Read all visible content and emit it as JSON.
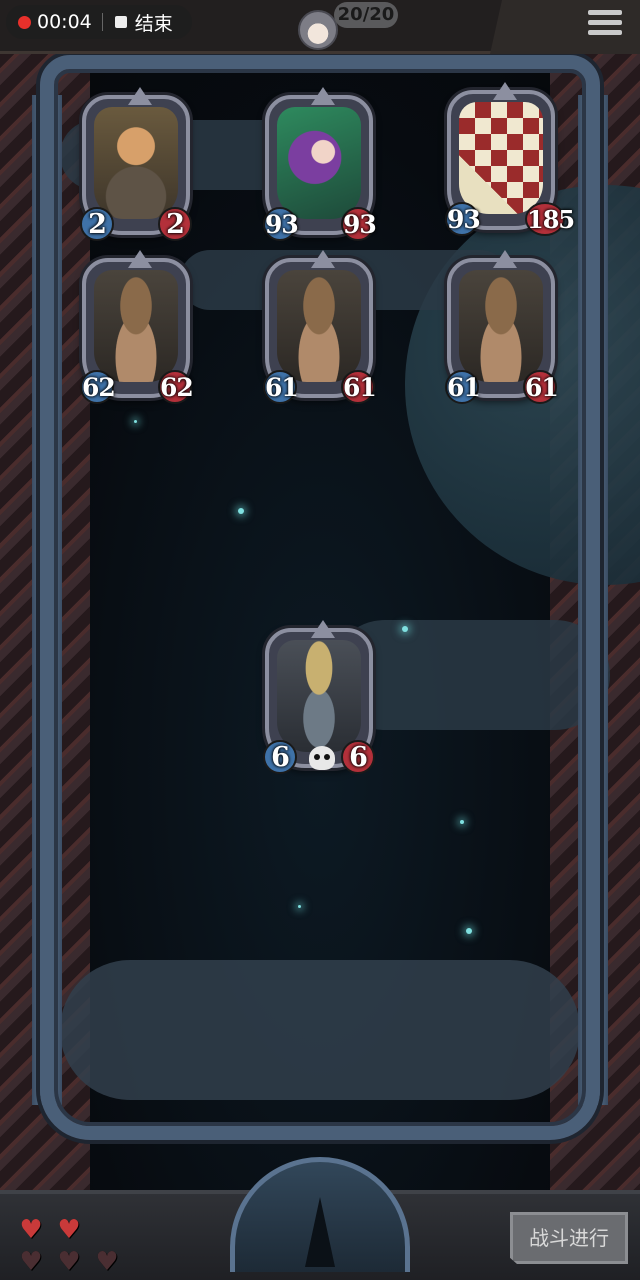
{
  "recording": {
    "time": "00:04",
    "stop_label": "结束"
  },
  "header": {
    "turn_counter": "20/20"
  },
  "enemy_cards": [
    {
      "name": "kid-card",
      "attack": "2",
      "health": "2"
    },
    {
      "name": "witch-card",
      "attack": "93",
      "health": "93"
    },
    {
      "name": "ace-card",
      "attack": "93",
      "health": "185"
    },
    {
      "name": "bucket-card-1",
      "attack": "62",
      "health": "62"
    },
    {
      "name": "bucket-card-2",
      "attack": "61",
      "health": "61"
    },
    {
      "name": "bucket-card-3",
      "attack": "61",
      "health": "61"
    }
  ],
  "player_card": {
    "attack": "6",
    "health": "6"
  },
  "lives": {
    "filled": 2,
    "total": 5
  },
  "battle_button": {
    "label": "战斗进行"
  },
  "colors": {
    "attack": "#3f72a8",
    "health": "#b3303a",
    "heart": "#c93a3a"
  }
}
